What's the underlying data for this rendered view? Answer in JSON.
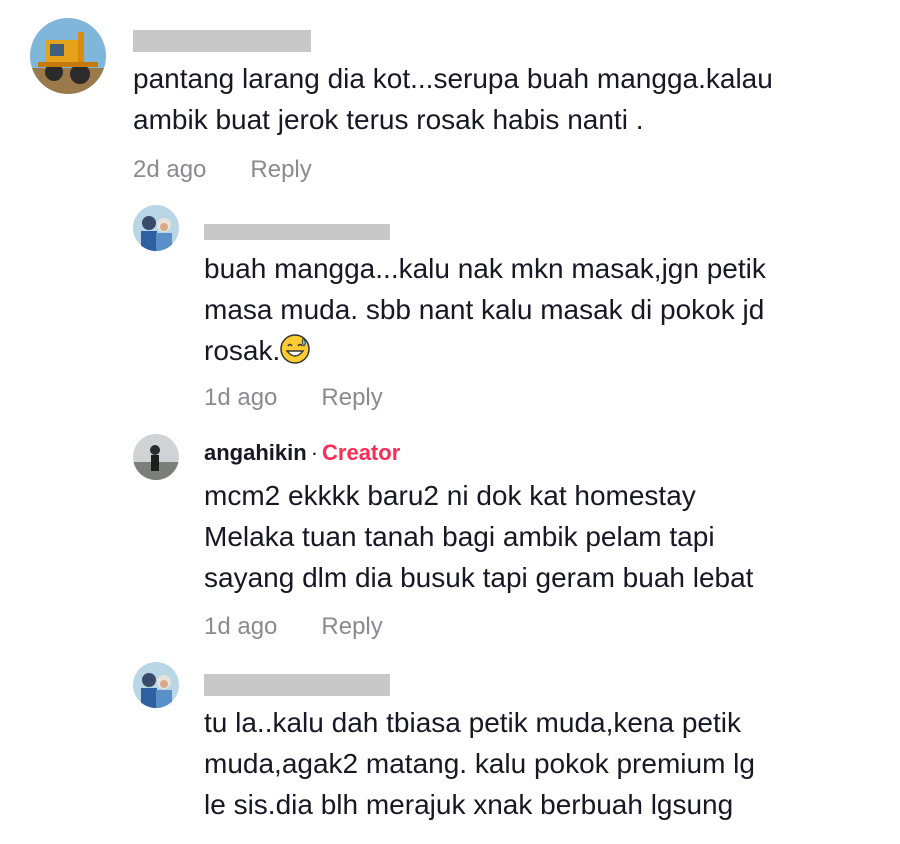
{
  "comments": [
    {
      "author": "",
      "text_lines": [
        "pantang larang dia kot...serupa buah mangga.kalau",
        "ambik buat jerok terus rosak habis nanti ."
      ],
      "time": "2d ago",
      "reply_label": "Reply"
    },
    {
      "author": "",
      "text_lines": [
        "buah mangga...kalu nak mkn masak,jgn petik",
        "masa muda. sbb nant kalu masak di pokok jd",
        "rosak."
      ],
      "emoji": "grinning-sweat-emoji",
      "time": "1d ago",
      "reply_label": "Reply"
    },
    {
      "author": "angahikin",
      "separator": "·",
      "badge": "Creator",
      "text_lines": [
        "mcm2 ekkkk baru2 ni dok kat homestay",
        "Melaka tuan tanah bagi ambik pelam tapi",
        "sayang dlm dia busuk tapi geram buah lebat"
      ],
      "time": "1d ago",
      "reply_label": "Reply"
    },
    {
      "author": "",
      "text_lines": [
        "tu la..kalu dah tbiasa petik muda,kena petik",
        "muda,agak2 matang. kalu pokok premium lg",
        "le sis.dia blh merajuk xnak berbuah lgsung"
      ]
    }
  ],
  "colors": {
    "text": "#161823",
    "meta": "#8a8b91",
    "creator_badge": "#fe2c55",
    "redaction": "#c8c8c8"
  }
}
